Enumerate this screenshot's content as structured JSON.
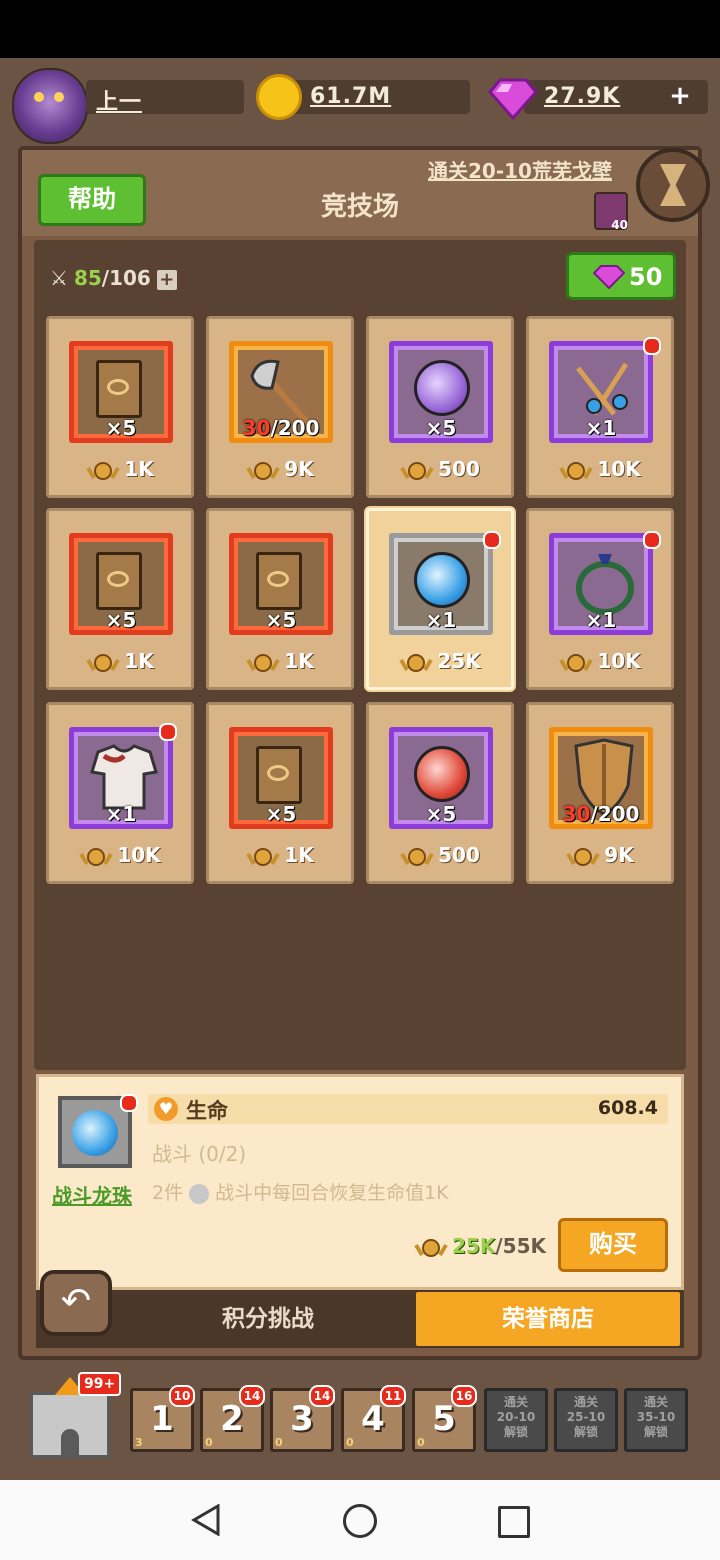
{
  "top_bar": {
    "player_name": "上一",
    "gold": "61.7M",
    "gems": "27.9K",
    "add_label": "+"
  },
  "header": {
    "help_label": "帮助",
    "title": "竞技场",
    "quest_link": "通关20-10荒芜戈壁",
    "badge_count": "40"
  },
  "shop": {
    "energy_current": "85",
    "energy_max": "/106",
    "refresh_cost": "50",
    "items": [
      {
        "name": "eye-skill-book",
        "qty": "×5",
        "price": "1K"
      },
      {
        "name": "battle-axe",
        "qty_red": "30",
        "qty": "/200",
        "price": "9K"
      },
      {
        "name": "purple-dragon-orb",
        "qty": "×5",
        "price": "500"
      },
      {
        "name": "twin-scepters",
        "qty": "×1",
        "price": "10K"
      },
      {
        "name": "swirl-skill-book",
        "qty": "×5",
        "price": "1K"
      },
      {
        "name": "horn-skill-book",
        "qty": "×5",
        "price": "1K"
      },
      {
        "name": "blue-dragon-orb",
        "qty": "×1",
        "price": "25K"
      },
      {
        "name": "vine-necklace",
        "qty": "×1",
        "price": "10K"
      },
      {
        "name": "cloth-armor",
        "qty": "×1",
        "price": "10K"
      },
      {
        "name": "skull-skill-book",
        "qty": "×5",
        "price": "1K"
      },
      {
        "name": "red-dragon-orb",
        "qty": "×5",
        "price": "500"
      },
      {
        "name": "wooden-shield",
        "qty_red": "30",
        "qty": "/200",
        "price": "9K"
      }
    ]
  },
  "detail": {
    "set_name": "战斗龙珠",
    "stat_label": "生命",
    "stat_value": "608.4",
    "set_line": "战斗 (0/2)",
    "set_bonus_count": "2件",
    "set_bonus_text": "战斗中每回合恢复生命值1K",
    "cost_current": "25K",
    "cost_max": "/55K",
    "buy_label": "购买"
  },
  "tabs": {
    "back_symbol": "↶",
    "points_challenge": "积分挑战",
    "honor_shop": "荣誉商店"
  },
  "stages": {
    "castle_badge": "99+",
    "slots": [
      {
        "num": "1",
        "badge": "10",
        "sub": "3"
      },
      {
        "num": "2",
        "badge": "14",
        "sub": "0"
      },
      {
        "num": "3",
        "badge": "14",
        "sub": "0"
      },
      {
        "num": "4",
        "badge": "11",
        "sub": "0"
      },
      {
        "num": "5",
        "badge": "16",
        "sub": "0"
      }
    ],
    "locked": [
      "通关\n20-10\n解锁",
      "通关\n25-10\n解锁",
      "通关\n35-10\n解锁"
    ]
  },
  "colors": {
    "accent_orange": "#f5a623",
    "accent_green": "#5fbf32",
    "rarity_red": "#e23c20",
    "rarity_purple": "#8c3dd9",
    "rarity_orange": "#f08c10"
  }
}
